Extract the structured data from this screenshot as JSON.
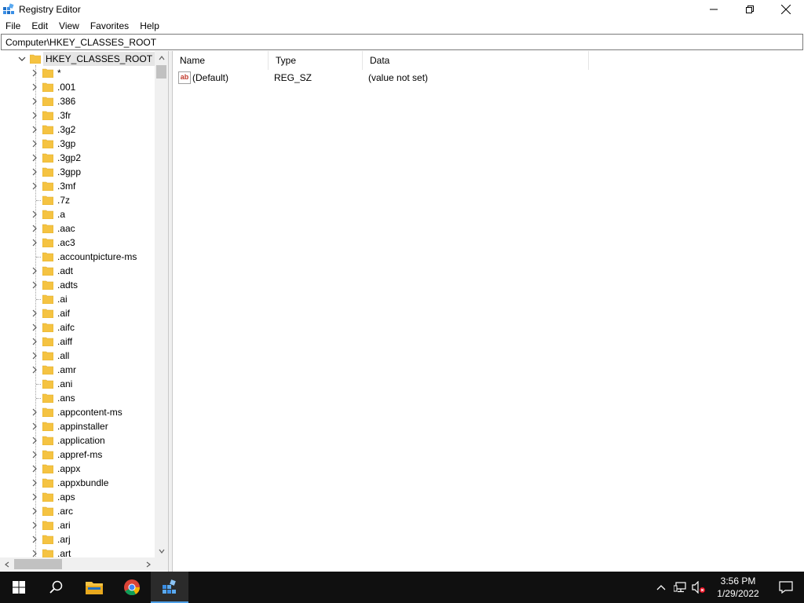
{
  "window": {
    "title": "Registry Editor"
  },
  "menu": [
    "File",
    "Edit",
    "View",
    "Favorites",
    "Help"
  ],
  "address": "Computer\\HKEY_CLASSES_ROOT",
  "tree": {
    "root": "HKEY_CLASSES_ROOT",
    "items": [
      {
        "label": "*",
        "expandable": true
      },
      {
        "label": ".001",
        "expandable": true
      },
      {
        "label": ".386",
        "expandable": true
      },
      {
        "label": ".3fr",
        "expandable": true
      },
      {
        "label": ".3g2",
        "expandable": true
      },
      {
        "label": ".3gp",
        "expandable": true
      },
      {
        "label": ".3gp2",
        "expandable": true
      },
      {
        "label": ".3gpp",
        "expandable": true
      },
      {
        "label": ".3mf",
        "expandable": true
      },
      {
        "label": ".7z",
        "expandable": false
      },
      {
        "label": ".a",
        "expandable": true
      },
      {
        "label": ".aac",
        "expandable": true
      },
      {
        "label": ".ac3",
        "expandable": true
      },
      {
        "label": ".accountpicture-ms",
        "expandable": false
      },
      {
        "label": ".adt",
        "expandable": true
      },
      {
        "label": ".adts",
        "expandable": true
      },
      {
        "label": ".ai",
        "expandable": false
      },
      {
        "label": ".aif",
        "expandable": true
      },
      {
        "label": ".aifc",
        "expandable": true
      },
      {
        "label": ".aiff",
        "expandable": true
      },
      {
        "label": ".all",
        "expandable": true
      },
      {
        "label": ".amr",
        "expandable": true
      },
      {
        "label": ".ani",
        "expandable": false
      },
      {
        "label": ".ans",
        "expandable": false
      },
      {
        "label": ".appcontent-ms",
        "expandable": true
      },
      {
        "label": ".appinstaller",
        "expandable": true
      },
      {
        "label": ".application",
        "expandable": true
      },
      {
        "label": ".appref-ms",
        "expandable": true
      },
      {
        "label": ".appx",
        "expandable": true
      },
      {
        "label": ".appxbundle",
        "expandable": true
      },
      {
        "label": ".aps",
        "expandable": true
      },
      {
        "label": ".arc",
        "expandable": true
      },
      {
        "label": ".ari",
        "expandable": true
      },
      {
        "label": ".arj",
        "expandable": true
      },
      {
        "label": ".art",
        "expandable": true
      }
    ]
  },
  "values": {
    "columns": [
      "Name",
      "Type",
      "Data"
    ],
    "rows": [
      {
        "name": "(Default)",
        "type": "REG_SZ",
        "data": "(value not set)",
        "icon": "string-value-icon"
      }
    ]
  },
  "taskbar": {
    "apps": [
      "start-icon",
      "search-icon",
      "file-explorer-icon",
      "chrome-icon",
      "regedit-icon"
    ],
    "time": "3:56 PM",
    "date": "1/29/2022"
  },
  "colors": {
    "taskbar_bg": "#101010",
    "folder": "#f5c342",
    "active_indicator": "#4ea0e8",
    "selection": "#e5e5e5"
  }
}
